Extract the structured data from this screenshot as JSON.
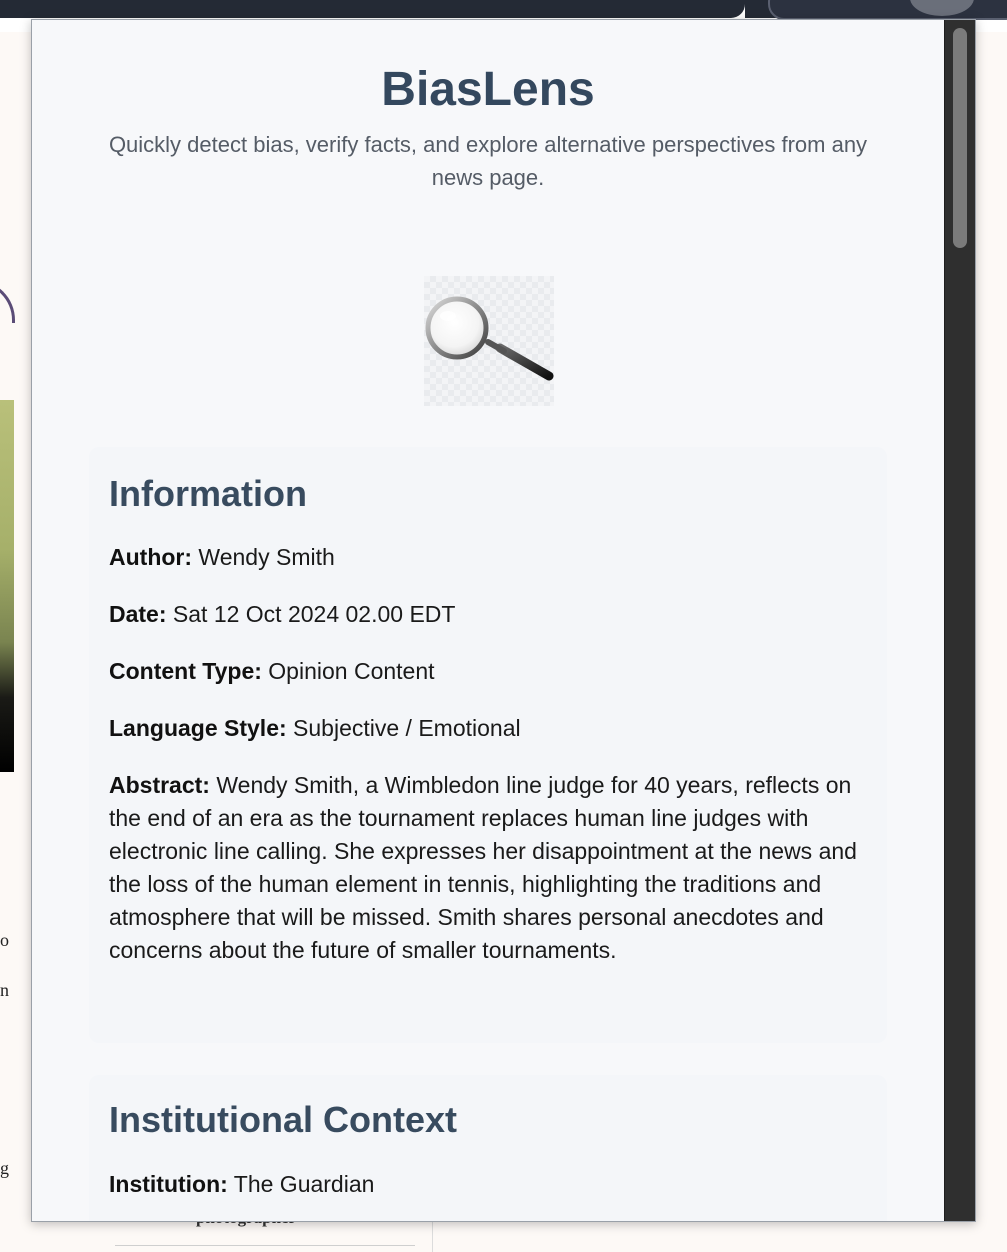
{
  "app": {
    "title": "BiasLens",
    "tagline": "Quickly detect bias, verify facts, and explore alternative perspectives from any news page.",
    "logo_icon": "magnifying-glass-icon"
  },
  "information": {
    "heading": "Information",
    "author_label": "Author:",
    "author": "Wendy Smith",
    "date_label": "Date:",
    "date": "Sat 12 Oct 2024 02.00 EDT",
    "content_type_label": "Content Type:",
    "content_type": "Opinion Content",
    "language_style_label": "Language Style:",
    "language_style": "Subjective / Emotional",
    "abstract_label": "Abstract:",
    "abstract": "Wendy Smith, a Wimbledon line judge for 40 years, reflects on the end of an era as the tournament replaces human line judges with electronic line calling. She expresses her disappointment at the news and the loss of the human element in tennis, highlighting the traditions and atmosphere that will be missed. Smith shares personal anecdotes and concerns about the future of smaller tournaments."
  },
  "institutional_context": {
    "heading": "Institutional Context",
    "institution_label": "Institution:",
    "institution": "The Guardian"
  },
  "background_page": {
    "caption_fragment": "photographer",
    "letters": [
      "o",
      "n",
      "g"
    ]
  },
  "colors": {
    "heading": "#34485e",
    "card_bg": "#f4f6f9",
    "popup_bg": "#f7f8fa",
    "scrollbar": "#2f2f2f"
  }
}
